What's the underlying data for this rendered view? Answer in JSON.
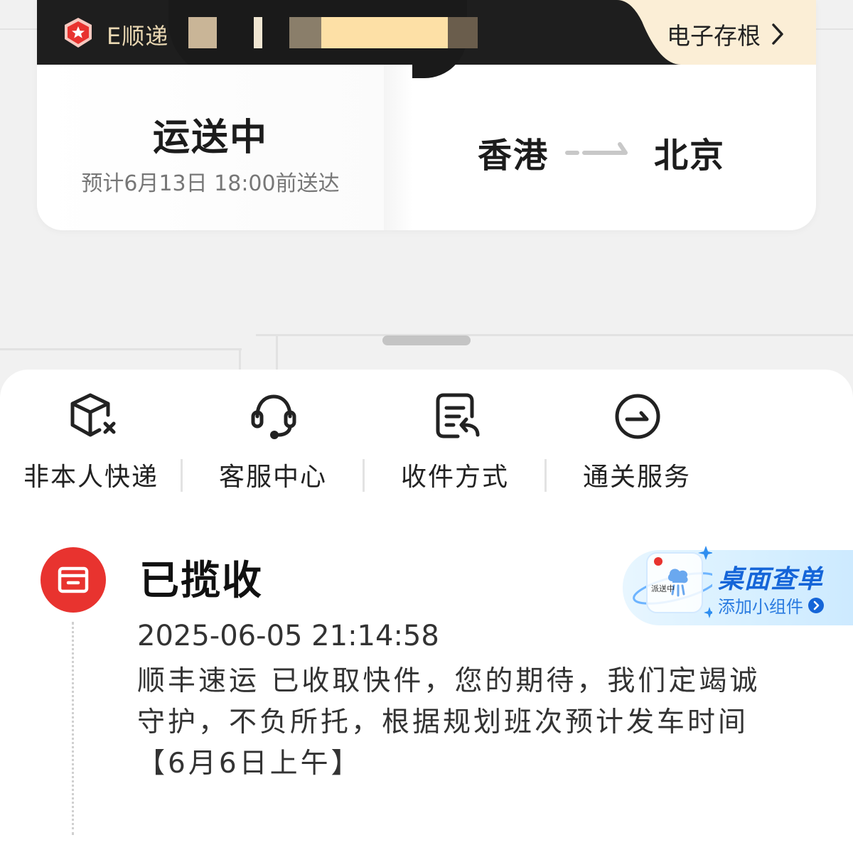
{
  "brand": {
    "name": "E顺递"
  },
  "header": {
    "stub_link": "电子存根"
  },
  "shipment": {
    "status": "运送中",
    "eta": "预计6月13日 18:00前送达",
    "from": "香港",
    "to": "北京"
  },
  "actions": [
    {
      "label": "非本人快递",
      "icon": "package-x-icon"
    },
    {
      "label": "客服中心",
      "icon": "headset-icon"
    },
    {
      "label": "收件方式",
      "icon": "receipt-return-icon"
    },
    {
      "label": "通关服务",
      "icon": "arrow-circle-icon"
    }
  ],
  "timeline": {
    "event_title": "已揽收",
    "event_time": "2025-06-05 21:14:58",
    "event_desc": "顺丰速运 已收取快件，您的期待，我们定竭诚守护，不负所托，根据规划班次预计发车时间【6月6日上午】"
  },
  "widget_promo": {
    "title": "桌面查单",
    "subtitle": "添加小组件",
    "thumb_label": "派送中"
  },
  "colors": {
    "accent_red": "#e8332f",
    "widget_blue": "#1565d8",
    "cream": "#fbeed6"
  }
}
